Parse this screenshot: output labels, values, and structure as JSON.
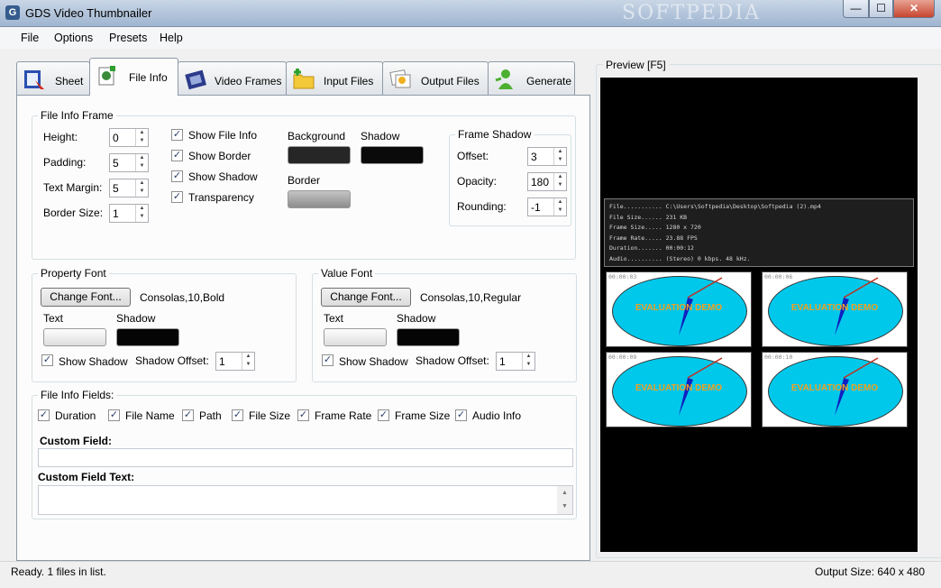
{
  "window": {
    "title": "GDS Video Thumbnailer",
    "watermark": "SOFTPEDIA",
    "min": "—",
    "max": "☐",
    "close": "✕"
  },
  "menu": [
    "File",
    "Options",
    "Presets",
    "Help"
  ],
  "tabs": [
    {
      "label": "Sheet",
      "icon": "sheet-icon"
    },
    {
      "label": "File Info",
      "icon": "file-info-icon"
    },
    {
      "label": "Video Frames",
      "icon": "film-strip-icon"
    },
    {
      "label": "Input Files",
      "icon": "folder-add-icon"
    },
    {
      "label": "Output Files",
      "icon": "pictures-icon"
    },
    {
      "label": "Generate",
      "icon": "user-run-icon"
    }
  ],
  "file_info_frame": {
    "title": "File Info Frame",
    "height": {
      "label": "Height:",
      "value": "0"
    },
    "padding": {
      "label": "Padding:",
      "value": "5"
    },
    "text_margin": {
      "label": "Text Margin:",
      "value": "5"
    },
    "border_size": {
      "label": "Border Size:",
      "value": "1"
    },
    "show_file_info": {
      "label": "Show File Info",
      "checked": true
    },
    "show_border": {
      "label": "Show Border",
      "checked": true
    },
    "show_shadow": {
      "label": "Show Shadow",
      "checked": true
    },
    "transparency": {
      "label": "Transparency",
      "checked": true
    },
    "background_label": "Background",
    "shadow_label": "Shadow",
    "border_label": "Border",
    "frame_shadow": {
      "title": "Frame Shadow",
      "offset": {
        "label": "Offset:",
        "value": "3"
      },
      "opacity": {
        "label": "Opacity:",
        "value": "180"
      },
      "rounding": {
        "label": "Rounding:",
        "value": "-1"
      }
    }
  },
  "property_font": {
    "title": "Property Font",
    "button": "Change Font...",
    "font": "Consolas,10,Bold",
    "text_label": "Text",
    "shadow_label": "Shadow",
    "show_shadow": "Show Shadow",
    "shadow_offset_label": "Shadow Offset:",
    "shadow_offset": "1"
  },
  "value_font": {
    "title": "Value Font",
    "button": "Change Font...",
    "font": "Consolas,10,Regular",
    "text_label": "Text",
    "shadow_label": "Shadow",
    "show_shadow": "Show Shadow",
    "shadow_offset_label": "Shadow Offset:",
    "shadow_offset": "1"
  },
  "file_info_fields": {
    "title": "File Info Fields:",
    "fields": [
      "Duration",
      "File Name",
      "Path",
      "File Size",
      "Frame Rate",
      "Frame Size",
      "Audio Info"
    ],
    "custom_field_label": "Custom Field:",
    "custom_field_value": "",
    "custom_field_text_label": "Custom Field Text:",
    "custom_field_text_value": ""
  },
  "preview": {
    "label": "Preview  [F5]",
    "info_lines": [
      "File........... C:\\Users\\Softpedia\\Desktop\\Softpedia (2).mp4",
      "File Size...... 231 KB",
      "Frame Size..... 1280 x 720",
      "Frame Rate..... 23.88 FPS",
      "Duration....... 00:00:12",
      "Audio.......... (Stereo) 0 kbps. 48 kHz."
    ],
    "thumbs": [
      {
        "time": "00:00:03",
        "text": "EVALUATION DEMO"
      },
      {
        "time": "00:00:06",
        "text": "EVALUATION DEMO"
      },
      {
        "time": "00:00:09",
        "text": "EVALUATION DEMO"
      },
      {
        "time": "00:00:10",
        "text": "EVALUATION DEMO"
      }
    ]
  },
  "status": {
    "left": "Ready. 1 files in list.",
    "right": "Output Size: 640 x 480"
  },
  "colors": {
    "background_swatch": "#262626",
    "shadow_swatch": "#0a0a0a",
    "border_swatch": "#9a9a9a",
    "dial": "#00c8ea",
    "demo_text": "#f2a020"
  }
}
